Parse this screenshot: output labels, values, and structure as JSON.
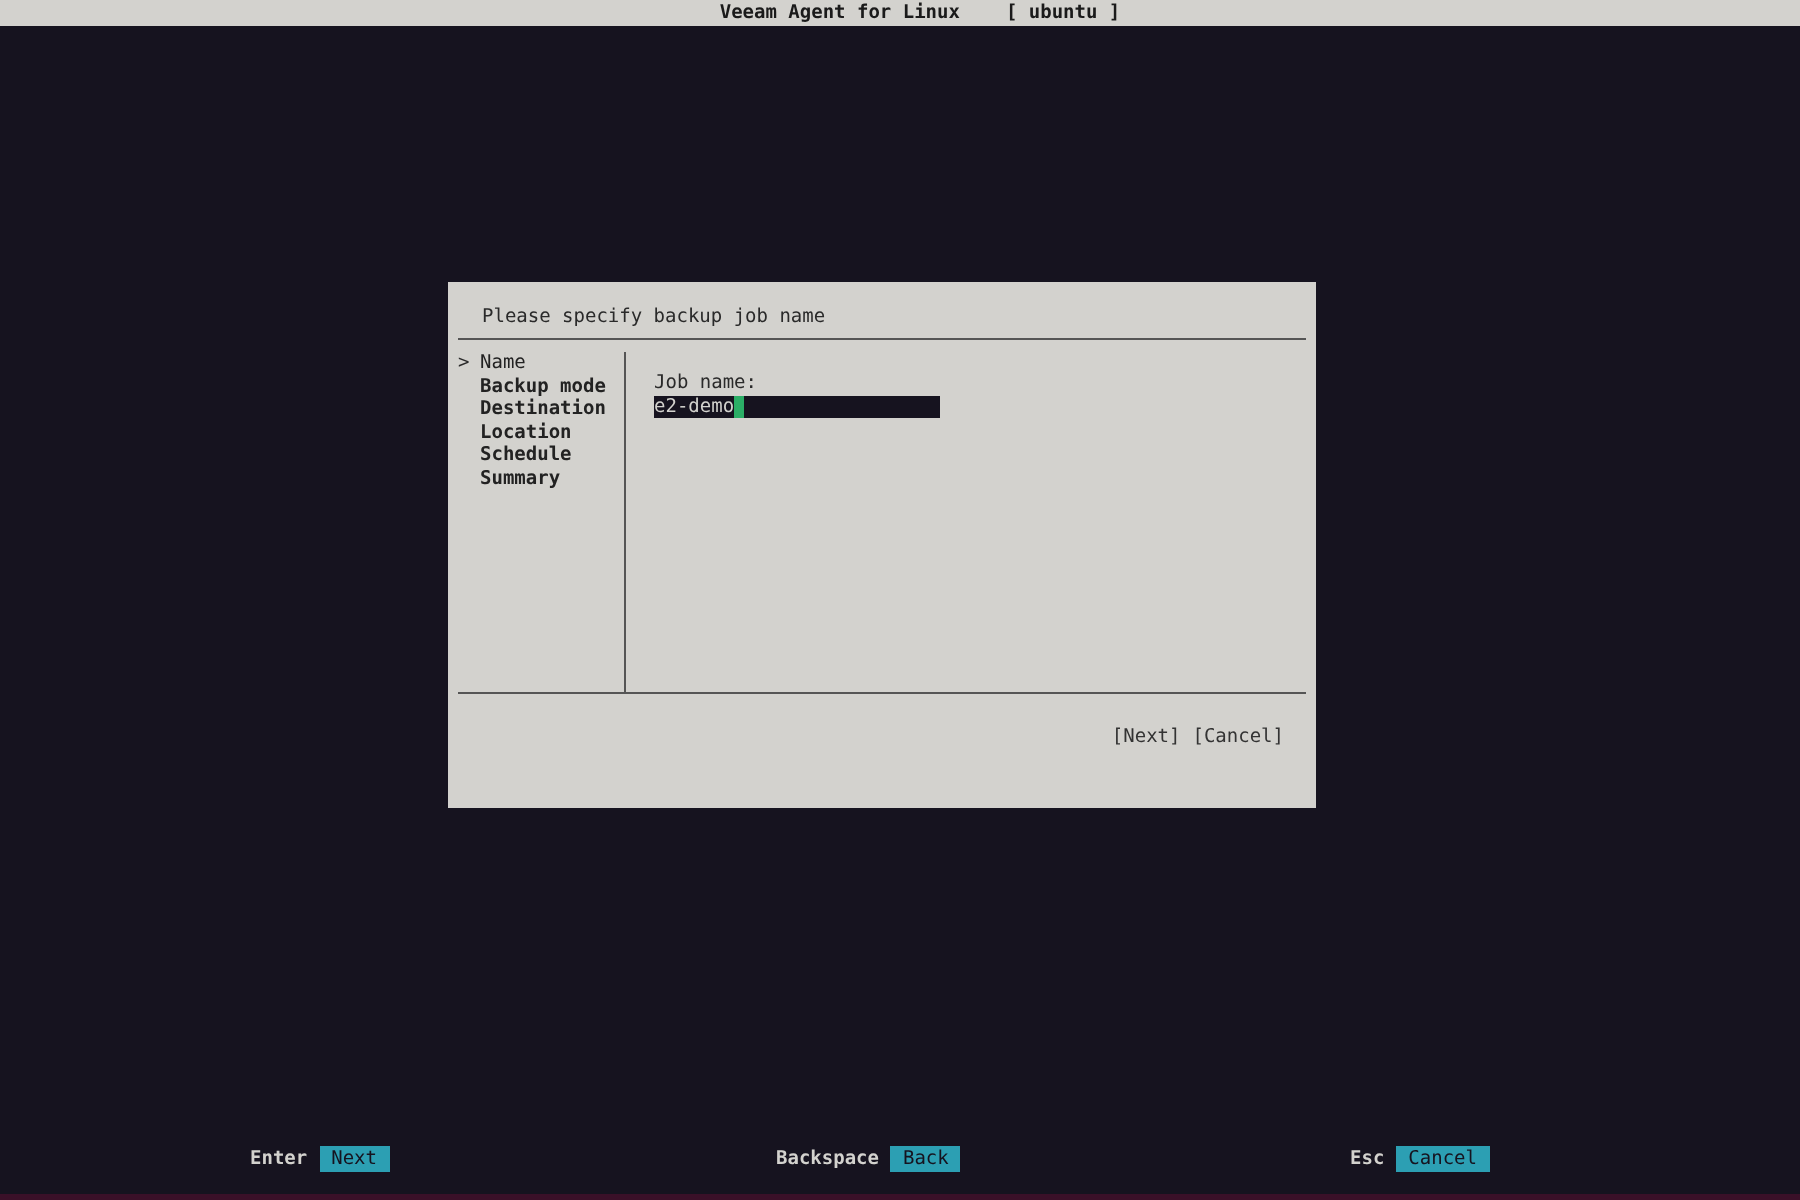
{
  "title_bar": {
    "app": "Veeam Agent for Linux",
    "host": "[ ubuntu ]"
  },
  "dialog": {
    "heading": "Please specify backup job name",
    "cursor": ">",
    "steps": [
      {
        "label": "Name",
        "selected": true
      },
      {
        "label": "Backup mode",
        "selected": false
      },
      {
        "label": "Destination",
        "selected": false
      },
      {
        "label": "Location",
        "selected": false
      },
      {
        "label": "Schedule",
        "selected": false
      },
      {
        "label": "Summary",
        "selected": false
      }
    ],
    "field": {
      "label": "Job name:",
      "value": "e2-demo"
    },
    "buttons": [
      "[Next]",
      "[Cancel]"
    ]
  },
  "footer": [
    {
      "key": "Enter",
      "action": "Next"
    },
    {
      "key": "Backspace",
      "action": "Back"
    },
    {
      "key": "Esc",
      "action": "Cancel"
    }
  ]
}
